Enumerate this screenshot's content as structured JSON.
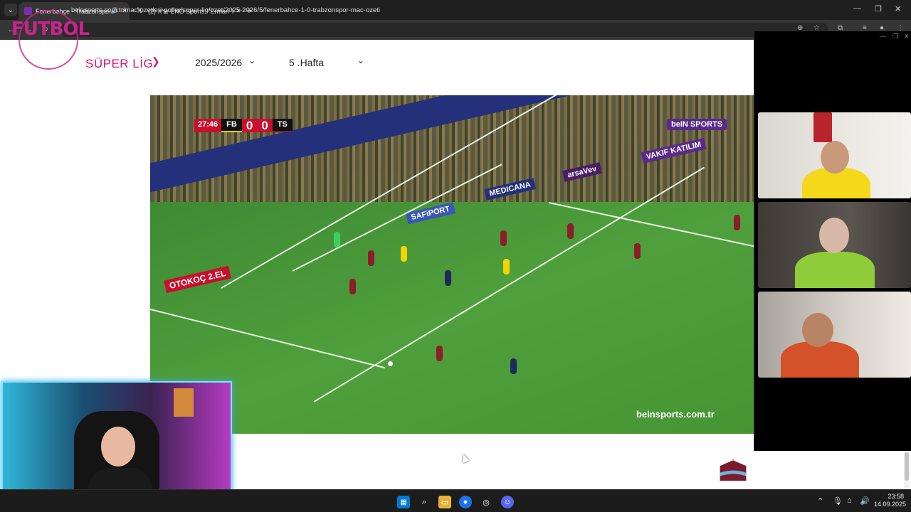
{
  "browser": {
    "tabs": [
      {
        "title": "Fenerbahçe - Trabzonspor M",
        "active": true
      },
      {
        "title": "(2) X'te ENO Sports: \"Erman To",
        "active": false
      }
    ],
    "url": "beinsports.com.tr/mac-ozetleri-goller/super-lig/ozet/2025-2026/5/fenerbahce-1-0-trabzonspor-mac-ozeti",
    "tab_icons": {
      "speaker": "speaker-icon",
      "close": "close-icon",
      "new_tab": "plus-icon"
    }
  },
  "page": {
    "logo_text": "FUTBOL",
    "league": "SÜPER LİG",
    "season": "2025/2026",
    "week": "5 .Hafta",
    "colors": {
      "accent": "#d7156f"
    }
  },
  "video": {
    "clock": "27:46",
    "home": "FB",
    "away": "TS",
    "home_score": "0",
    "away_score": "0",
    "broadcaster": "beIN SPORTS",
    "watermark": "beinsports.com.tr",
    "ads": [
      "OTOKOÇ 2.EL",
      "VAKIF KATILIM",
      "MEDICANA",
      "arsaVev",
      "SAFiPORT"
    ]
  },
  "taskbar": {
    "time": "23:58",
    "date": "14.09.2025"
  }
}
